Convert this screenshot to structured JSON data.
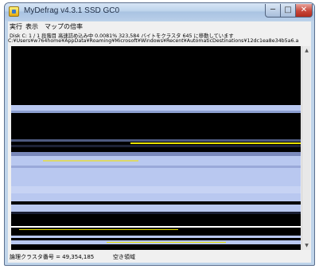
{
  "window": {
    "title": "MyDefrag v4.3.1    SSD GC0",
    "min_glyph": "─",
    "max_glyph": "□",
    "close_glyph": "✕"
  },
  "menu": [
    {
      "label": "実行"
    },
    {
      "label": "表示"
    },
    {
      "label": "マップの倍率"
    }
  ],
  "status": {
    "line1": "Disk C:  1 / 1 段階目  高速詰め込み中  0.0081%  323,584 バイトをクラスタ 645 に移動しています",
    "line2": "C:¥Users¥w764home¥AppData¥Roaming¥Microsoft¥Windows¥Recent¥AutomaticDestinations¥12dc1ea8e34b5a6.a"
  },
  "statusbar": {
    "cluster": "論理クラスタ番号 = 49,354,185",
    "region": "空き領域"
  },
  "scrollbar": {
    "up_glyph": "▲",
    "down_glyph": "▼"
  },
  "colors": {
    "map_background": "#000000",
    "used_block": "#b9c8f0",
    "fragmented_block": "#e8e000",
    "selection_white": "#ffffff"
  }
}
